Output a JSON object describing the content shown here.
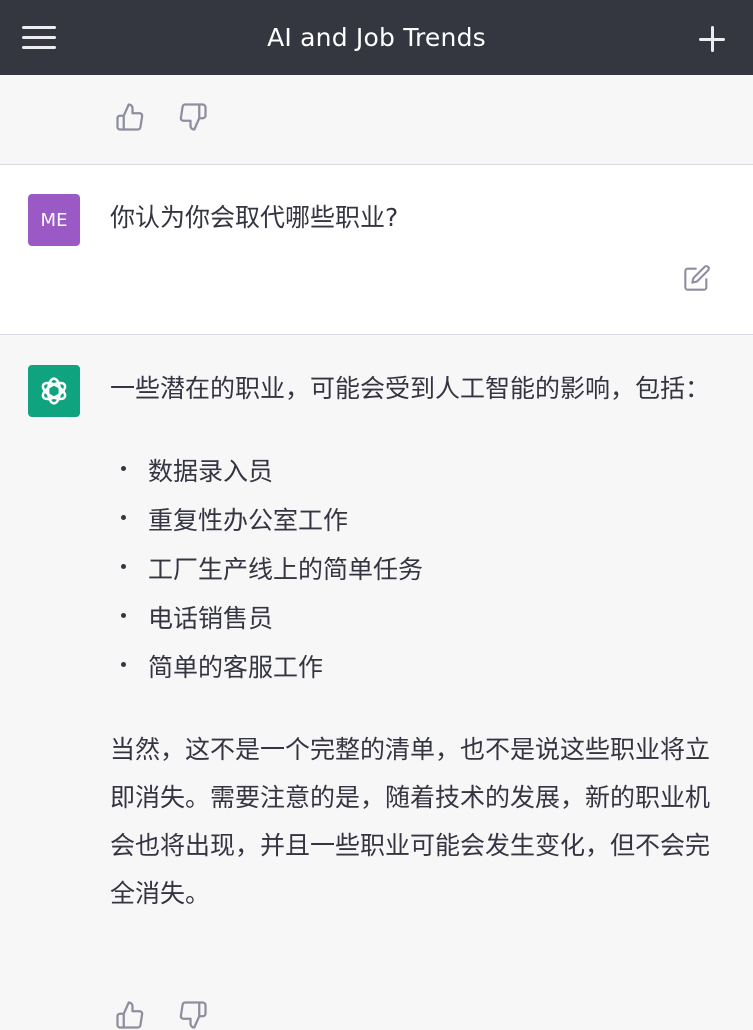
{
  "header": {
    "title": "AI and Job Trends",
    "menu_icon": "hamburger-menu-icon",
    "new_chat_icon": "plus-icon"
  },
  "feedback": {
    "like_icon": "thumbs-up-icon",
    "dislike_icon": "thumbs-down-icon"
  },
  "user_message": {
    "avatar_initials": "ME",
    "avatar_color": "#9b59c5",
    "text": "你认为你会取代哪些职业?",
    "edit_icon": "edit-icon"
  },
  "assistant_message": {
    "avatar_icon": "openai-logo-icon",
    "avatar_color": "#10a37f",
    "intro": "一些潜在的职业，可能会受到人工智能的影响，包括：",
    "items": [
      "数据录入员",
      "重复性办公室工作",
      "工厂生产线上的简单任务",
      "电话销售员",
      "简单的客服工作"
    ],
    "conclusion": "当然，这不是一个完整的清单，也不是说这些职业将立即消失。需要注意的是，随着技术的发展，新的职业机会也将出现，并且一些职业可能会发生变化，但不会完全消失。"
  },
  "colors": {
    "header_bg": "#353740",
    "page_bg": "#f7f7f8",
    "message_bg": "#ffffff",
    "text": "#343541"
  }
}
